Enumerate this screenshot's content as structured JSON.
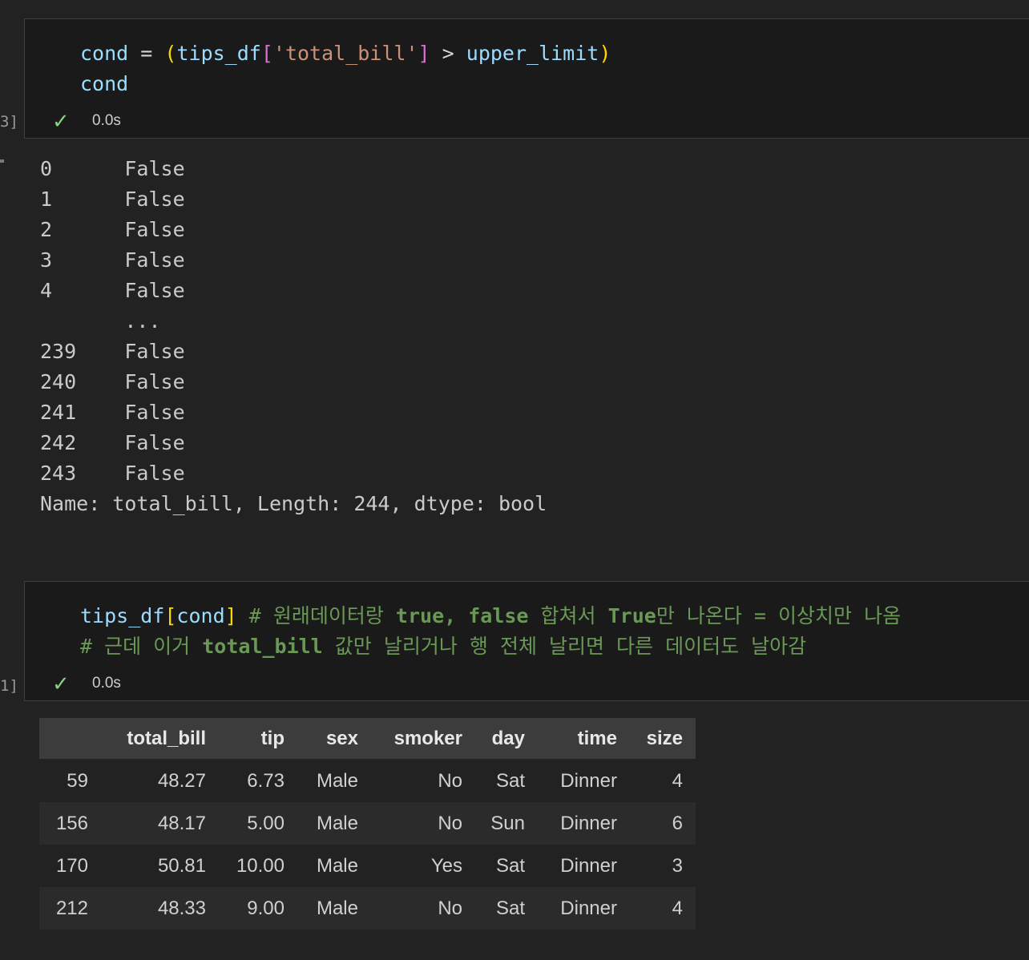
{
  "theme": {
    "success_green": "#89d185",
    "syntax": {
      "variable": "#9CDCFE",
      "string": "#CE9178",
      "comment": "#6A9955",
      "bracket_gold": "#FFD700",
      "bracket_pink": "#DA70D6",
      "operator": "#D4D4D4"
    }
  },
  "cell1": {
    "exec_fragment": "3]",
    "check_icon": "✓",
    "duration": "0.0s",
    "code": [
      [
        {
          "t": "cond",
          "c": "v"
        },
        {
          "t": " ",
          "c": "p"
        },
        {
          "t": "=",
          "c": "o"
        },
        {
          "t": " ",
          "c": "p"
        },
        {
          "t": "(",
          "c": "b1"
        },
        {
          "t": "tips_df",
          "c": "v"
        },
        {
          "t": "[",
          "c": "b2"
        },
        {
          "t": "'total_bill'",
          "c": "s"
        },
        {
          "t": "]",
          "c": "b2"
        },
        {
          "t": " ",
          "c": "p"
        },
        {
          "t": ">",
          "c": "o"
        },
        {
          "t": " ",
          "c": "p"
        },
        {
          "t": "upper_limit",
          "c": "v"
        },
        {
          "t": ")",
          "c": "b1"
        }
      ],
      [
        {
          "t": "cond",
          "c": "v"
        }
      ]
    ]
  },
  "output1": {
    "lines": [
      "0      False",
      "1      False",
      "2      False",
      "3      False",
      "4      False",
      "       ...",
      "239    False",
      "240    False",
      "241    False",
      "242    False",
      "243    False",
      "Name: total_bill, Length: 244, dtype: bool"
    ]
  },
  "cell2": {
    "exec_fragment": "1]",
    "check_icon": "✓",
    "duration": "0.0s",
    "code": [
      [
        {
          "t": "tips_df",
          "c": "v"
        },
        {
          "t": "[",
          "c": "b1"
        },
        {
          "t": "cond",
          "c": "v"
        },
        {
          "t": "]",
          "c": "b1"
        },
        {
          "t": " ",
          "c": "p"
        },
        {
          "t": "# 원래데이터랑 ",
          "c": "c"
        },
        {
          "t": "true, false",
          "c": "cb"
        },
        {
          "t": " 합쳐서 ",
          "c": "c"
        },
        {
          "t": "True",
          "c": "cb"
        },
        {
          "t": "만 나온다 = 이상치만 나옴",
          "c": "c"
        }
      ],
      [
        {
          "t": "# 근데 이거 ",
          "c": "c"
        },
        {
          "t": "total_bill",
          "c": "cb"
        },
        {
          "t": " 값만 날리거나 행 전체 날리면 다른 데이터도 날아감",
          "c": "c"
        }
      ]
    ]
  },
  "output2": {
    "columns": [
      "",
      "total_bill",
      "tip",
      "sex",
      "smoker",
      "day",
      "time",
      "size"
    ],
    "rows": [
      [
        "59",
        "48.27",
        "6.73",
        "Male",
        "No",
        "Sat",
        "Dinner",
        "4"
      ],
      [
        "156",
        "48.17",
        "5.00",
        "Male",
        "No",
        "Sun",
        "Dinner",
        "6"
      ],
      [
        "170",
        "50.81",
        "10.00",
        "Male",
        "Yes",
        "Sat",
        "Dinner",
        "3"
      ],
      [
        "212",
        "48.33",
        "9.00",
        "Male",
        "No",
        "Sat",
        "Dinner",
        "4"
      ]
    ]
  }
}
